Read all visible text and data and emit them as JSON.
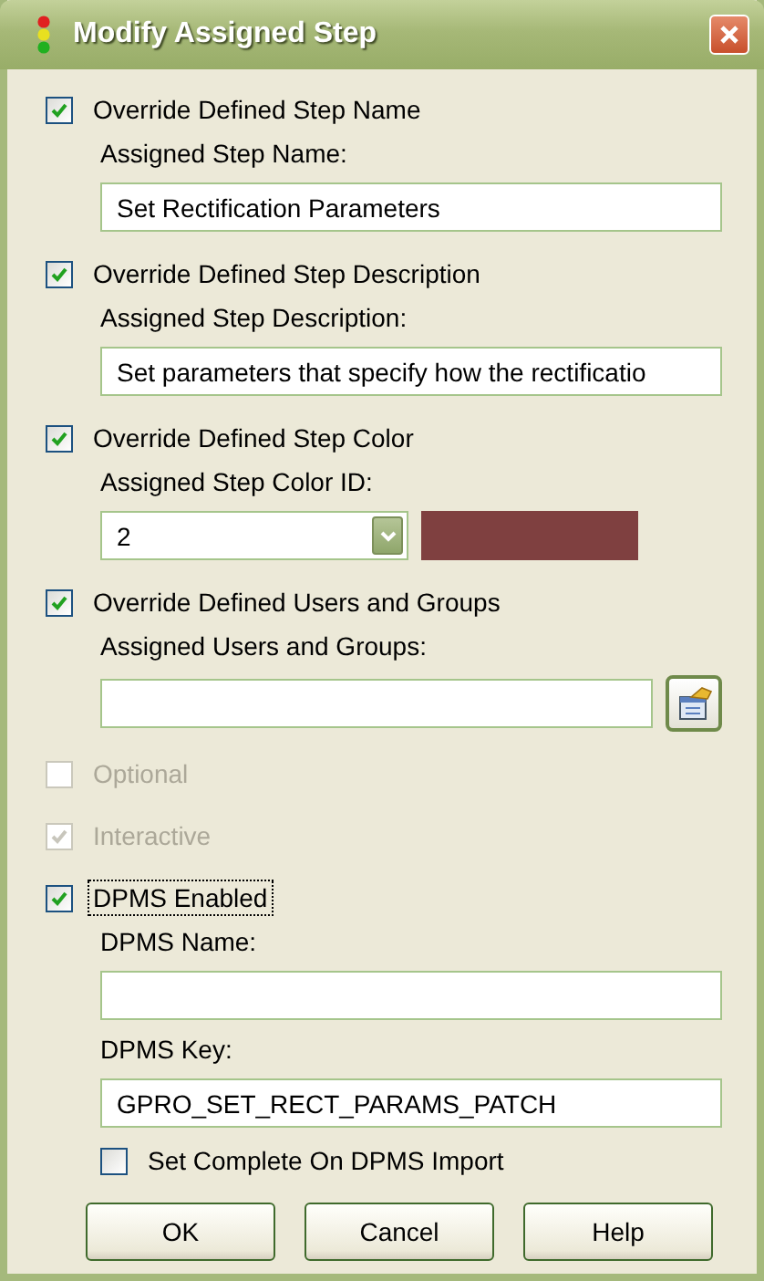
{
  "window": {
    "title": "Modify Assigned Step"
  },
  "options": [
    {
      "label": "Override Defined Step Name",
      "checked": true,
      "disabled": false,
      "focused": false,
      "children": [
        {
          "kind": "label",
          "text": "Assigned Step Name:"
        },
        {
          "kind": "field",
          "value": "Set Rectification Parameters"
        }
      ]
    },
    {
      "label": "Override Defined Step Description",
      "checked": true,
      "disabled": false,
      "focused": false,
      "children": [
        {
          "kind": "label",
          "text": "Assigned Step Description:"
        },
        {
          "kind": "field",
          "value": "Set parameters that specify how the rectificatio"
        }
      ]
    },
    {
      "label": "Override Defined Step Color",
      "checked": true,
      "disabled": false,
      "focused": false,
      "children": [
        {
          "kind": "label",
          "text": "Assigned Step Color ID:"
        },
        {
          "kind": "combo",
          "value": "2",
          "color": "#7f4040"
        }
      ]
    },
    {
      "label": "Override Defined Users and Groups",
      "checked": true,
      "disabled": false,
      "focused": false,
      "children": [
        {
          "kind": "label",
          "text": "Assigned Users and Groups:"
        },
        {
          "kind": "picker"
        }
      ]
    },
    {
      "label": "Optional",
      "checked": false,
      "disabled": true,
      "focused": false
    },
    {
      "label": "Interactive",
      "checked": true,
      "disabled": true,
      "focused": false
    },
    {
      "label": "DPMS Enabled",
      "checked": true,
      "disabled": false,
      "focused": true,
      "children": [
        {
          "kind": "label",
          "text": "DPMS Name:"
        },
        {
          "kind": "field"
        },
        {
          "kind": "label",
          "text": "DPMS Key:"
        },
        {
          "kind": "field",
          "value": "GPRO_SET_RECT_PARAMS_PATCH"
        },
        {
          "kind": "checkbox",
          "label": "Set Complete On DPMS Import",
          "checked": false,
          "disabled": false,
          "focused": false
        }
      ]
    }
  ],
  "buttons": [
    "OK",
    "Cancel",
    "Help"
  ]
}
